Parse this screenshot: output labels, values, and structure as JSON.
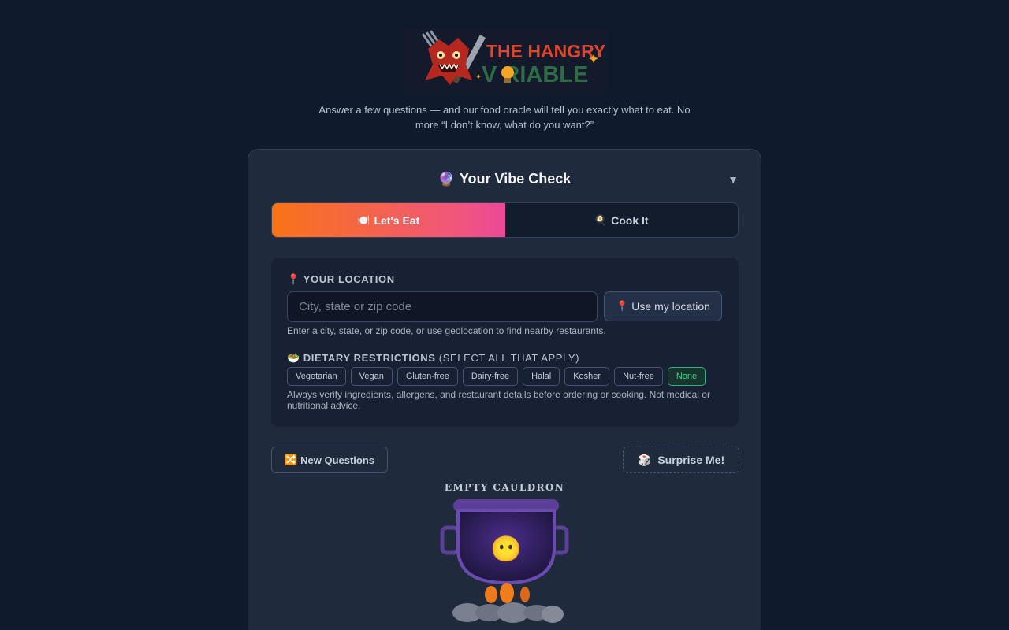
{
  "logo": {
    "line1": "THE HANGRY",
    "line2": "V RIABLE",
    "alt": "The Hangry Variable"
  },
  "tagline": "Answer a few questions — and our food oracle will tell you exactly what to eat. No more “I don’t know, what do you want?”",
  "card": {
    "title": "Your Vibe Check",
    "title_emoji": "🔮",
    "collapse_icon": "▼"
  },
  "modes": [
    {
      "label": "Let's Eat",
      "emoji": "🍽️",
      "active": true
    },
    {
      "label": "Cook It",
      "emoji": "🍳",
      "active": false
    }
  ],
  "location": {
    "label": "YOUR LOCATION",
    "emoji": "📍",
    "placeholder": "City, state or zip code",
    "value": "",
    "geo_button": "Use my location",
    "geo_emoji": "📍",
    "help": "Enter a city, state, or zip code, or use geolocation to find nearby restaurants."
  },
  "dietary": {
    "label": "DIETARY RESTRICTIONS",
    "label_suffix": "(SELECT ALL THAT APPLY)",
    "emoji": "🥗",
    "options": [
      "Vegetarian",
      "Vegan",
      "Gluten-free",
      "Dairy-free",
      "Halal",
      "Kosher",
      "Nut-free",
      "None"
    ],
    "selected": "None",
    "disclaimer": "Always verify ingredients, allergens, and restaurant details before ordering or cooking. Not medical or nutritional advice."
  },
  "actions": {
    "new_questions": "New Questions",
    "new_emoji": "🔀",
    "surprise": "Surprise Me!",
    "surprise_emoji": "🎲"
  },
  "cauldron": {
    "label": "EMPTY CAULDRON",
    "face": "😶"
  },
  "colors": {
    "background": "#101a2d",
    "accent_start": "#f97316",
    "accent_end": "#ec4899",
    "selected_chip": "#2bb673"
  }
}
